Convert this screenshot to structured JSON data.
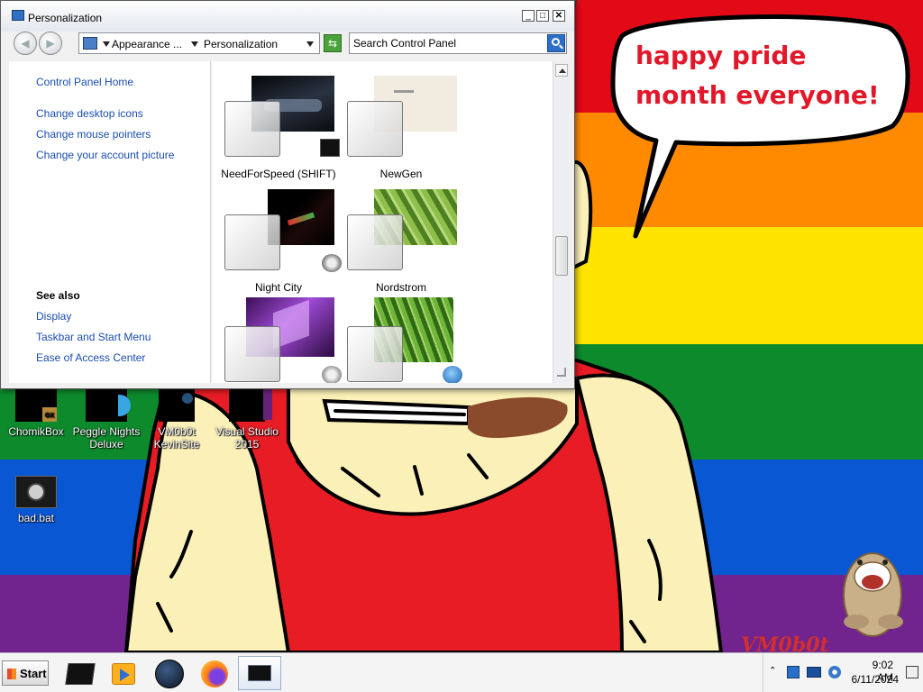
{
  "window": {
    "title": "Personalization",
    "caption_buttons": {
      "minimize": "_",
      "maximize": "□",
      "close": "✕"
    }
  },
  "address": {
    "segments": [
      "Appearance ...",
      "Personalization"
    ],
    "search_placeholder": "Search Control Panel"
  },
  "left_pane": {
    "links": [
      "Control Panel Home",
      "Change desktop icons",
      "Change mouse pointers",
      "Change your account picture"
    ],
    "see_also_heading": "See also",
    "see_also_links": [
      "Display",
      "Taskbar and Start Menu",
      "Ease of Access Center"
    ]
  },
  "themes": [
    {
      "name": "NeedForSpeed (SHIFT)",
      "preview_color": "#1c2330"
    },
    {
      "name": "NewGen",
      "preview_color": "#efe7dc"
    },
    {
      "name": "Night City",
      "preview_color": "#0d0d0d"
    },
    {
      "name": "Nordstrom",
      "preview_color": "#5d8f2e"
    },
    {
      "name": "",
      "preview_color": "#6b2a8c"
    },
    {
      "name": "",
      "preview_color": "#3f7d1f"
    }
  ],
  "wallpaper": {
    "speech_bubble": "happy pride month everyone!",
    "stripe_colors": [
      "#e30a17",
      "#ff8a00",
      "#ffe400",
      "#0d8a2c",
      "#0a57d4",
      "#71238e"
    ]
  },
  "desktop_icons": [
    {
      "label": "ChomikBox"
    },
    {
      "label": "Peggle Nights Deluxe"
    },
    {
      "label": "VM0b0t KevinSite"
    },
    {
      "label": "Visual Studio 2015"
    },
    {
      "label": "bad.bat"
    }
  ],
  "taskbar": {
    "start_label": "Start",
    "time": "9:02 AM",
    "date": "6/11/2024"
  }
}
